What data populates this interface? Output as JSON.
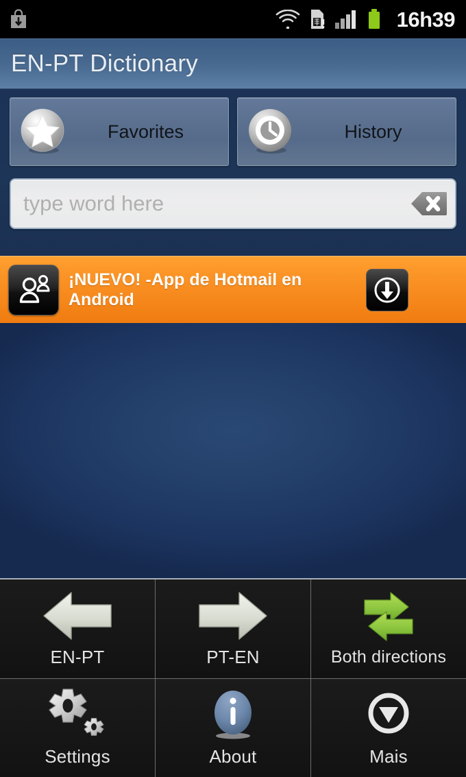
{
  "statusbar": {
    "download_icon": "play-store-download-icon",
    "wifi_icon": "wifi-icon",
    "sim_icon": "sim-card-alert-icon",
    "signal_icon": "cellular-signal-icon",
    "battery_icon": "battery-full-icon",
    "clock": "16h39"
  },
  "header": {
    "title": "EN-PT Dictionary"
  },
  "toolbar": {
    "favorites_label": "Favorites",
    "favorites_icon": "star-icon",
    "history_label": "History",
    "history_icon": "clock-icon"
  },
  "search": {
    "placeholder": "type word here",
    "value": "",
    "clear_icon": "backspace-clear-icon"
  },
  "ad": {
    "icon": "contacts-people-icon",
    "text": "¡NUEVO! -App de Hotmail en Android",
    "download_icon": "download-arrow-icon"
  },
  "nav": {
    "rows": [
      [
        {
          "label": "EN-PT",
          "icon": "arrow-left-icon"
        },
        {
          "label": "PT-EN",
          "icon": "arrow-right-icon"
        },
        {
          "label": "Both directions",
          "icon": "both-directions-arrows-icon"
        }
      ],
      [
        {
          "label": "Settings",
          "icon": "gears-icon"
        },
        {
          "label": "About",
          "icon": "info-icon"
        },
        {
          "label": "Mais",
          "icon": "chevron-down-circle-icon"
        }
      ]
    ]
  },
  "colors": {
    "accent_orange": "#f5861a",
    "title_blue": "#4b6d93",
    "content_blue": "#23406a",
    "nav_black": "#1a1a1a",
    "green_arrow": "#8cc63f",
    "battery_green": "#8ec919"
  }
}
